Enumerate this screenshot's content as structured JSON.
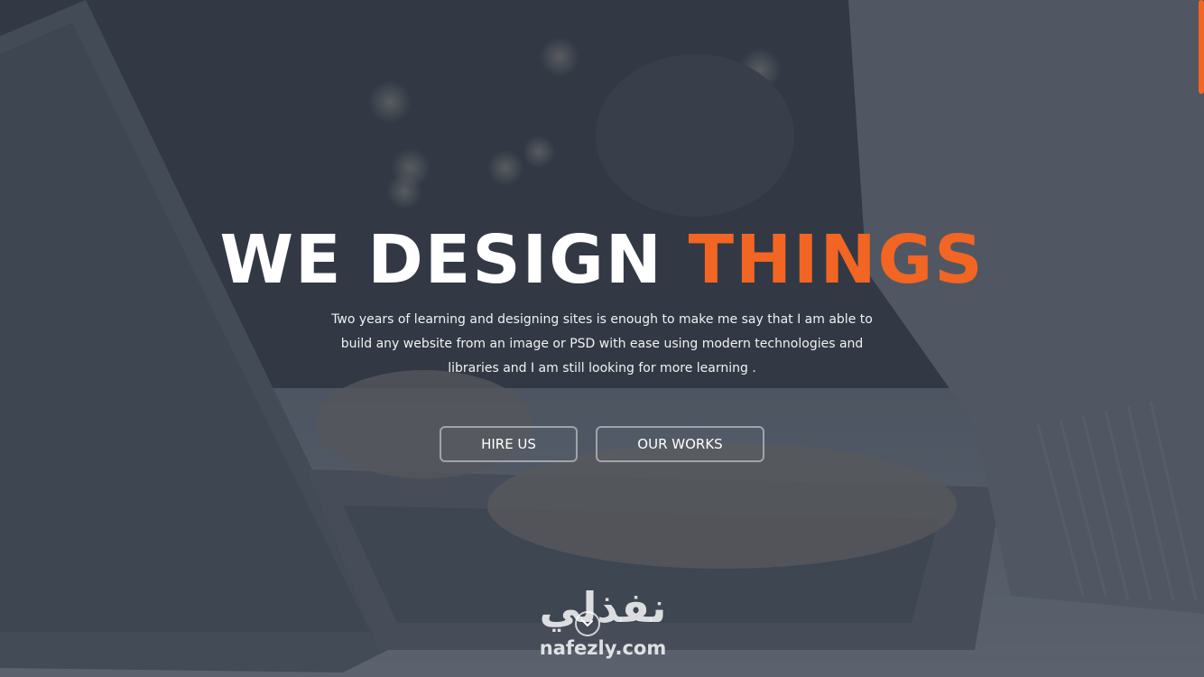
{
  "hero": {
    "headline_main": "WE DESIGN ",
    "headline_accent": "THINGS",
    "description": "Two years of learning and designing sites is enough to make me say that I am able to build any website from an image or PSD with ease using modern technologies and libraries and I am still looking for more learning .",
    "buttons": {
      "hire_label": "HIRE US",
      "works_label": "OUR WORKS"
    },
    "scroll_icon": "chevron-down-icon"
  },
  "watermark": {
    "arabic": "نفذلي",
    "latin": "nafezly.com"
  },
  "colors": {
    "accent": "#f26522",
    "overlay": "#3f4652",
    "text": "#ffffff"
  }
}
